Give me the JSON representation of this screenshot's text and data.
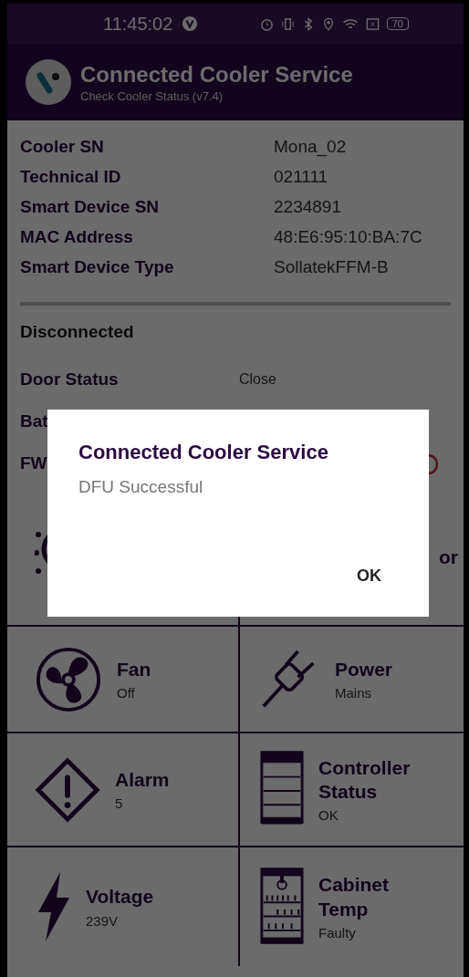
{
  "status_bar": {
    "time": "11:45:02",
    "battery": "70"
  },
  "header": {
    "title": "Connected Cooler Service",
    "subtitle": "Check Cooler Status (v7.4)"
  },
  "device_info": [
    {
      "label": "Cooler SN",
      "value": "Mona_02"
    },
    {
      "label": "Technical ID",
      "value": "021111"
    },
    {
      "label": "Smart Device SN",
      "value": "2234891"
    },
    {
      "label": "MAC Address",
      "value": "48:E6:95:10:BA:7C"
    },
    {
      "label": "Smart Device Type",
      "value": "SollatekFFM-B"
    }
  ],
  "connection_status": "Disconnected",
  "status_rows": [
    {
      "label": "Door Status",
      "value": "Close",
      "indicator": false
    },
    {
      "label": "Bat",
      "indicator": false
    },
    {
      "label": "FW",
      "indicator": true
    }
  ],
  "sensors": [
    {
      "kind": "light"
    },
    {
      "kind": "compressor",
      "title": "or"
    },
    {
      "kind": "fan",
      "title": "Fan",
      "value": "Off"
    },
    {
      "kind": "power",
      "title": "Power",
      "value": "Mains"
    },
    {
      "kind": "alarm",
      "title": "Alarm",
      "value": "5"
    },
    {
      "kind": "controller",
      "title": "Controller Status",
      "value": "OK"
    },
    {
      "kind": "voltage",
      "title": "Voltage",
      "value": "239V"
    },
    {
      "kind": "cabinet",
      "title": "Cabinet Temp",
      "value": "Faulty"
    }
  ],
  "dialog": {
    "title": "Connected Cooler Service",
    "message": "DFU Successful",
    "button": "OK"
  }
}
